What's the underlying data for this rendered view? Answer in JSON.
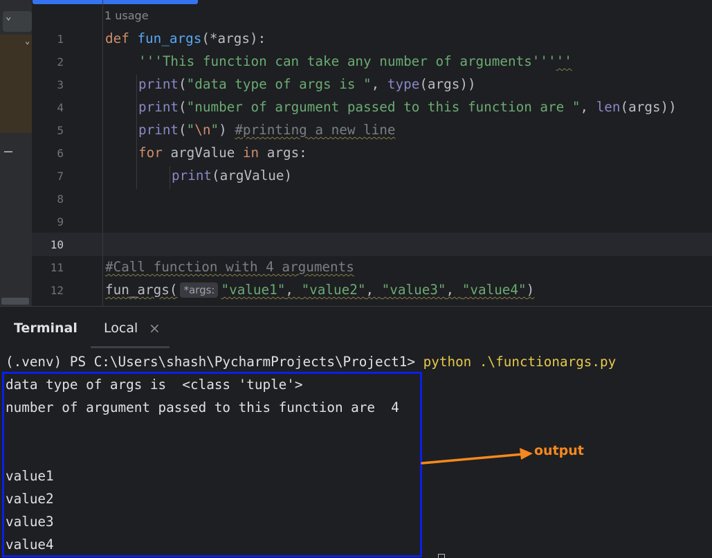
{
  "editor": {
    "usage_hint": "1 usage",
    "line_numbers": [
      "1",
      "2",
      "3",
      "4",
      "5",
      "6",
      "7",
      "8",
      "9",
      "10",
      "11",
      "12"
    ],
    "current_line": "10",
    "code": {
      "l1_kw": "def ",
      "l1_fn": "fun_args",
      "l1_rest": "(*args):",
      "l2_doc": "'''This function can take any number of arguments'''",
      "l2_extra": "''",
      "l3_print": "print",
      "l3_open": "(",
      "l3_str": "\"data type of args is \"",
      "l3_comma": ", ",
      "l3_type": "type",
      "l3_rest": "(args))",
      "l4_print": "print",
      "l4_open": "(",
      "l4_str": "\"number of argument passed to this function are \"",
      "l4_comma": ", ",
      "l4_len": "len",
      "l4_rest": "(args))",
      "l5_print": "print",
      "l5_open": "(",
      "l5_q1": "\"",
      "l5_esc": "\\n",
      "l5_q2": "\"",
      "l5_close": ") ",
      "l5_comment": "#printing a new line",
      "l6_for": "for ",
      "l6_var": "argValue ",
      "l6_in": "in ",
      "l6_rest": "args:",
      "l7_print": "print",
      "l7_rest": "(argValue)",
      "l11_comment": "#Call function with 4 arguments",
      "l12_call": "fun_args(",
      "l12_hint": "*args:",
      "l12_a1": "\"value1\"",
      "l12_c1": ", ",
      "l12_a2": "\"value2\"",
      "l12_c2": ", ",
      "l12_a3": "\"value3\"",
      "l12_c3": ", ",
      "l12_a4": "\"value4\"",
      "l12_end": ")"
    }
  },
  "panel": {
    "title": "Terminal",
    "tab_label": "Local",
    "tab_close": "×"
  },
  "terminal": {
    "prompt": "(.venv) PS C:\\Users\\shash\\PycharmProjects\\Project1> ",
    "command": "python .\\functionargs.py",
    "output_lines": [
      "data type of args is  <class 'tuple'>",
      "number of argument passed to this function are  4",
      "",
      "",
      "value1",
      "value2",
      "value3",
      "value4"
    ]
  },
  "annotation": {
    "label": "output",
    "arrow_color": "#f5891f",
    "box_color": "#0a1fe8"
  }
}
